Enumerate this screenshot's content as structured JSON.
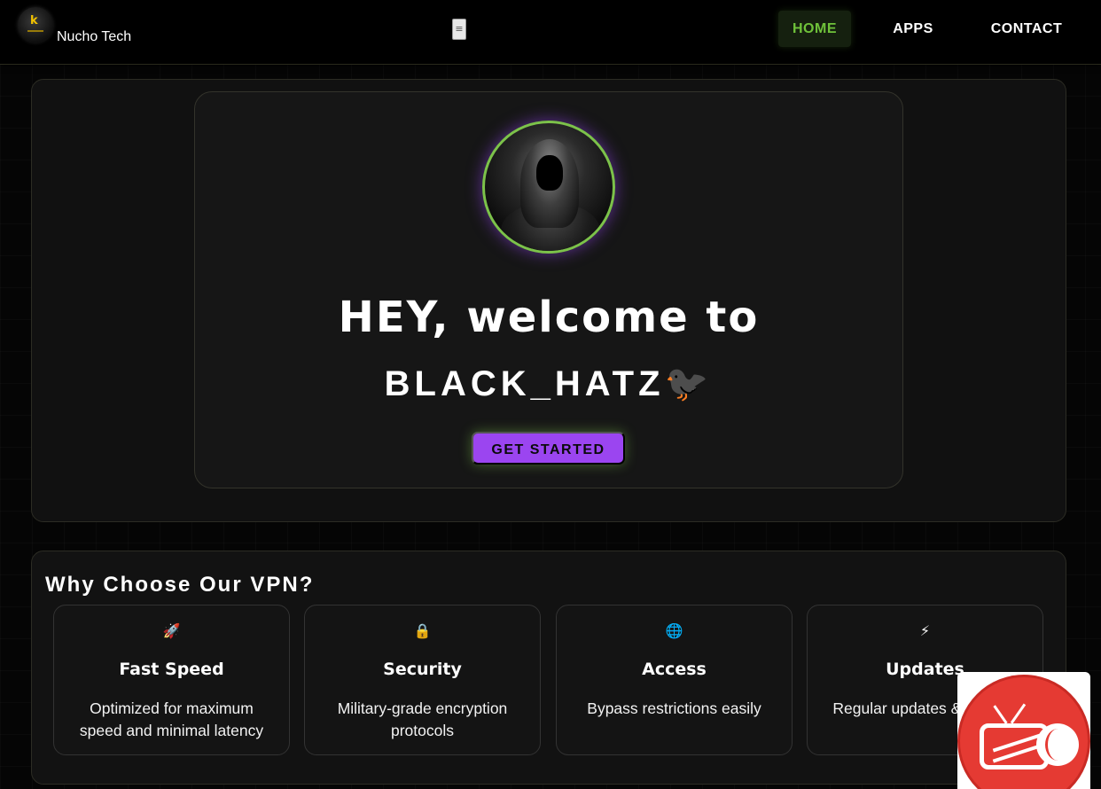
{
  "nav": {
    "brand": "Nucho Tech",
    "menu_toggle": "≡",
    "links": [
      {
        "label": "HOME",
        "active": true
      },
      {
        "label": "APPS",
        "active": false
      },
      {
        "label": "CONTACT",
        "active": false
      }
    ]
  },
  "hero": {
    "title": "HEY, welcome to",
    "subtitle": "BLACK_HATZ🐦‍⬛",
    "cta_label": "GET STARTED"
  },
  "features": {
    "title": "Why Choose Our VPN?",
    "cards": [
      {
        "icon": "🚀",
        "icon_name": "rocket-icon",
        "title": "Fast Speed",
        "text": "Optimized for maximum speed and minimal latency"
      },
      {
        "icon": "🔒",
        "icon_name": "lock-icon",
        "title": "Security",
        "text": "Military-grade encryption protocols"
      },
      {
        "icon": "🌐",
        "icon_name": "globe-icon",
        "title": "Access",
        "text": "Bypass restrictions easily"
      },
      {
        "icon": "⚡",
        "icon_name": "lightning-icon",
        "title": "Updates",
        "text": "Regular updates & support"
      }
    ]
  },
  "colors": {
    "accent_green": "#6fc23a",
    "accent_purple": "#9b45f0",
    "background": "#050505"
  }
}
